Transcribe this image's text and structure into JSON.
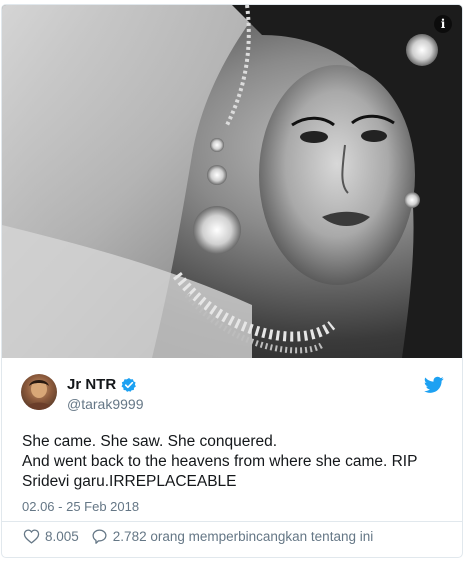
{
  "tweet": {
    "user": {
      "display_name": "Jr NTR",
      "handle": "@tarak9999",
      "verified": true
    },
    "text_lines": [
      "She came. She saw. She conquered.",
      "And went back to the heavens from where she came. RIP",
      "Sridevi garu.IRREPLACEABLE"
    ],
    "timestamp": "02.06 - 25 Feb 2018",
    "likes": "8.005",
    "replies": "2.782 orang memperbincangkan tentang ini"
  },
  "icons": {
    "info": "info-icon",
    "verified": "verified-badge-icon",
    "twitter": "twitter-bird-icon",
    "like": "heart-icon",
    "reply": "speech-bubble-icon"
  },
  "colors": {
    "twitter_blue": "#1da1f2",
    "muted_text": "#657786",
    "border": "#e1e8ed"
  }
}
